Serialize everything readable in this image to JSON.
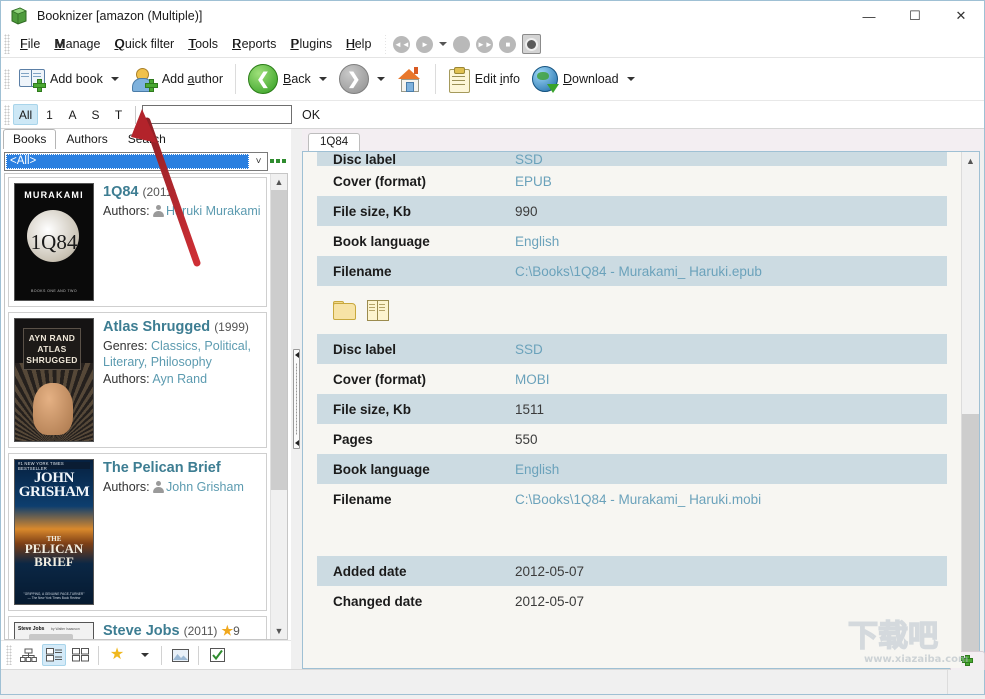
{
  "window": {
    "title": "Booknizer [amazon (Multiple)]",
    "app_icon": "books-stack-icon",
    "controls": {
      "minimize": "—",
      "maximize": "☐",
      "close": "✕"
    }
  },
  "menubar": {
    "items": [
      {
        "label": "File",
        "accel": "F"
      },
      {
        "label": "Manage",
        "accel": "M"
      },
      {
        "label": "Quick filter",
        "accel": "Q"
      },
      {
        "label": "Tools",
        "accel": "T"
      },
      {
        "label": "Reports",
        "accel": "R"
      },
      {
        "label": "Plugins",
        "accel": "P"
      },
      {
        "label": "Help",
        "accel": "H"
      }
    ],
    "media_buttons": [
      "rewind-icon",
      "play-icon",
      "dropdown-caret-icon",
      "record-icon",
      "fast-forward-icon",
      "stop-icon",
      "speaker-icon"
    ]
  },
  "toolbar": {
    "add_book": "Add book",
    "add_author": "Add author",
    "back": "Back",
    "forward": "",
    "home": "",
    "edit_info": "Edit info",
    "download": "Download"
  },
  "quickfilter": {
    "letters": [
      "All",
      "1",
      "A",
      "S",
      "T"
    ],
    "active_letter": "All",
    "input_value": "",
    "input_placeholder": "",
    "ok_label": "OK"
  },
  "left_panel": {
    "tabs": [
      {
        "label": "Books",
        "active": true
      },
      {
        "label": "Authors",
        "active": false
      },
      {
        "label": "Search",
        "active": false
      }
    ],
    "filter_combo": {
      "value": "<All>",
      "caret": "⌄"
    },
    "more_button": "more-options-icon",
    "books": [
      {
        "cover": "1q84-cover",
        "cover_author": "MURAKAMI",
        "cover_title": "1Q84",
        "cover_sub": "BOOKS ONE AND TWO",
        "title": "1Q84",
        "year": "(2011)",
        "fields": [
          {
            "label": "Authors:",
            "value": "Haruki Murakami",
            "icon": "person-icon"
          }
        ],
        "rating": ""
      },
      {
        "cover": "atlas-shrugged-cover",
        "cover_line1": "AYN RAND",
        "cover_line2": "ATLAS",
        "cover_line3": "SHRUGGED",
        "title": "Atlas Shrugged",
        "year": "(1999)",
        "fields": [
          {
            "label": "Genres:",
            "value": "Classics, Political, Literary, Philosophy",
            "icon": ""
          },
          {
            "label": "Authors:",
            "value": "Ayn Rand",
            "icon": ""
          }
        ],
        "rating": ""
      },
      {
        "cover": "pelican-brief-cover",
        "cover_band": "#1 NEW YORK TIMES BESTSELLER",
        "cover_author": "JOHN GRISHAM",
        "cover_title": "THE PELICAN BRIEF",
        "title": "The Pelican Brief",
        "year": "",
        "fields": [
          {
            "label": "Authors:",
            "value": "John Grisham",
            "icon": "person-icon"
          }
        ],
        "rating": ""
      },
      {
        "cover": "steve-jobs-cover",
        "cover_title": "Steve Jobs",
        "cover_sub": "by Walter Isaacson",
        "title": "Steve Jobs",
        "year": "(2011)",
        "fields": [],
        "rating": "9"
      }
    ],
    "view_buttons": [
      {
        "name": "tree-view-button",
        "active": false
      },
      {
        "name": "details-view-button",
        "active": true
      },
      {
        "name": "thumbnail-view-button",
        "active": false
      },
      {
        "name": "rating-filter-button",
        "active": false
      },
      {
        "name": "rating-dropdown-button",
        "active": false
      },
      {
        "name": "cover-toggle-button",
        "active": false
      },
      {
        "name": "checkbox-toggle-button",
        "active": false
      }
    ]
  },
  "right_panel": {
    "tabs": [
      {
        "label": "1Q84",
        "active": true
      },
      {
        "label": "",
        "active": false,
        "icon": "add-tab-icon"
      }
    ],
    "sections": [
      {
        "rows": [
          {
            "label": "Disc label",
            "value": "SSD",
            "link": true,
            "shade": true,
            "clipped": true
          },
          {
            "label": "Cover (format)",
            "value": "EPUB",
            "link": true,
            "shade": false
          },
          {
            "label": "File size, Kb",
            "value": "990",
            "link": false,
            "shade": true
          },
          {
            "label": "Book language",
            "value": "English",
            "link": true,
            "shade": false
          },
          {
            "label": "Filename",
            "value": "C:\\Books\\1Q84 - Murakami_ Haruki.epub",
            "link": true,
            "shade": true
          }
        ],
        "action_icons": [
          "open-folder-icon",
          "open-book-icon"
        ]
      },
      {
        "rows": [
          {
            "label": "Disc label",
            "value": "SSD",
            "link": true,
            "shade": true
          },
          {
            "label": "Cover (format)",
            "value": "MOBI",
            "link": true,
            "shade": false
          },
          {
            "label": "File size, Kb",
            "value": "1511",
            "link": false,
            "shade": true
          },
          {
            "label": "Pages",
            "value": "550",
            "link": false,
            "shade": false
          },
          {
            "label": "Book language",
            "value": "English",
            "link": true,
            "shade": true
          },
          {
            "label": "Filename",
            "value": "C:\\Books\\1Q84 - Murakami_ Haruki.mobi",
            "link": true,
            "shade": false
          }
        ],
        "action_icons": []
      },
      {
        "rows": [
          {
            "label": "Added date",
            "value": "2012-05-07",
            "link": false,
            "shade": true
          },
          {
            "label": "Changed date",
            "value": "2012-05-07",
            "link": false,
            "shade": false
          }
        ],
        "action_icons": []
      }
    ]
  },
  "statusbar": {
    "cells": [
      "",
      "",
      ""
    ]
  },
  "watermark": {
    "text": "下载吧",
    "url": "www.xiazaiba.com"
  },
  "annotation": {
    "type": "red-arrow",
    "points_to": "quickfilter-input"
  },
  "colors": {
    "accent_blue": "#2a7fe0",
    "link_teal": "#6ba2bb",
    "title_teal": "#3d7d92",
    "row_shade": "#ccdbe2",
    "panel_bg": "#f7f6f2",
    "annotation_red": "#c0272d"
  }
}
